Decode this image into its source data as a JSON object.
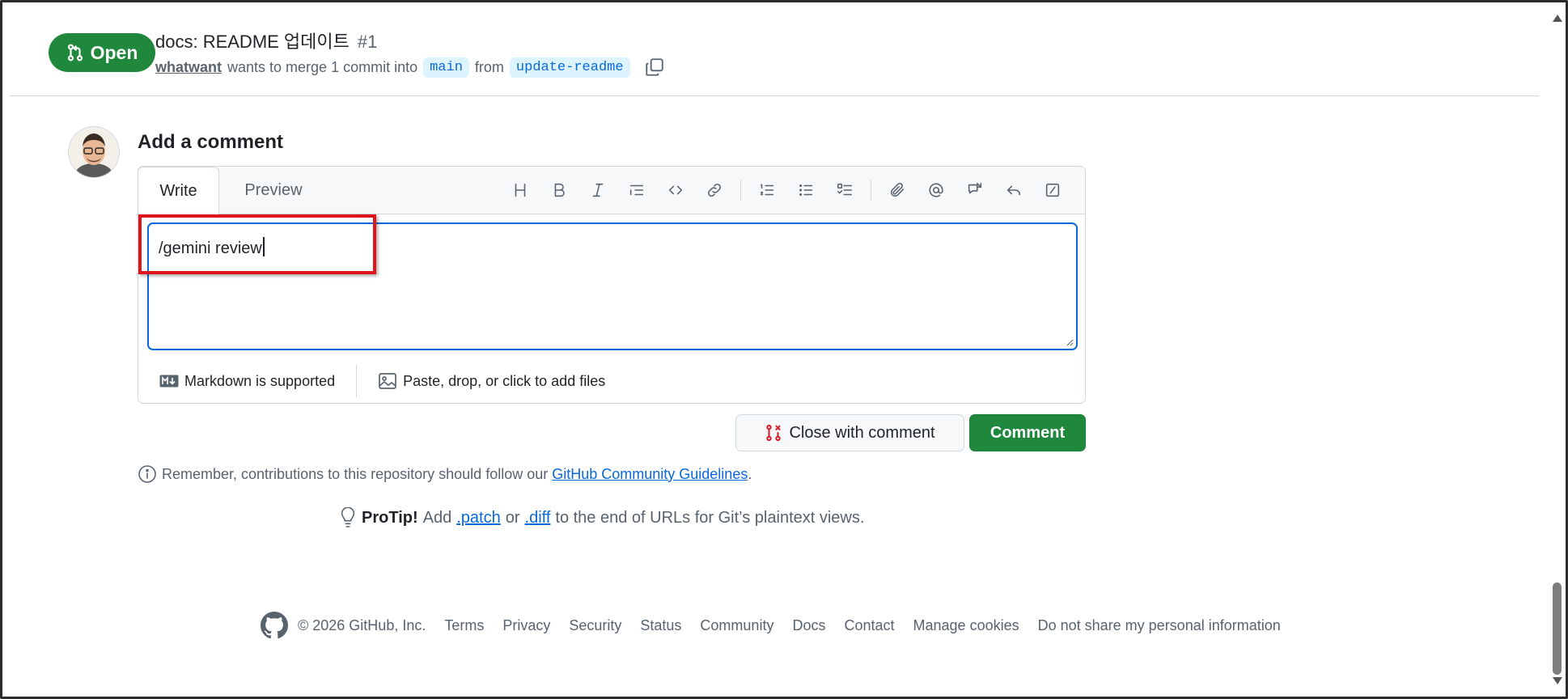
{
  "pr": {
    "state": "Open",
    "title": "docs: README 업데이트",
    "number": "#1",
    "author": "whatwant",
    "merge_text": "wants to merge 1 commit into",
    "base_branch": "main",
    "from_text": "from",
    "head_branch": "update-readme"
  },
  "comment": {
    "heading": "Add a comment",
    "tabs": [
      "Write",
      "Preview"
    ],
    "toolbar_icons": [
      "heading-icon",
      "bold-icon",
      "italic-icon",
      "quote-icon",
      "code-icon",
      "link-icon",
      "numbered-list-icon",
      "unordered-list-icon",
      "task-list-icon",
      "attach-icon",
      "mention-icon",
      "cross-reference-icon",
      "saved-reply-icon",
      "slash-command-icon"
    ],
    "text": "/gemini review",
    "markdown_note": "Markdown is supported",
    "attach_note": "Paste, drop, or click to add files",
    "close_button": "Close with comment",
    "comment_button": "Comment"
  },
  "guidelines": {
    "prefix": "Remember, contributions to this repository should follow our",
    "link": "GitHub Community Guidelines",
    "suffix": "."
  },
  "protip": {
    "label": "ProTip!",
    "text1": "Add",
    "patch": ".patch",
    "or": "or",
    "diff": ".diff",
    "text2": "to the end of URLs for Git’s plaintext views."
  },
  "footer": {
    "copyright": "© 2026 GitHub, Inc.",
    "links": [
      "Terms",
      "Privacy",
      "Security",
      "Status",
      "Community",
      "Docs",
      "Contact",
      "Manage cookies",
      "Do not share my personal information"
    ]
  },
  "colors": {
    "open_green": "#1f883d",
    "link_blue": "#0969da",
    "highlight_red": "#e0151b"
  }
}
